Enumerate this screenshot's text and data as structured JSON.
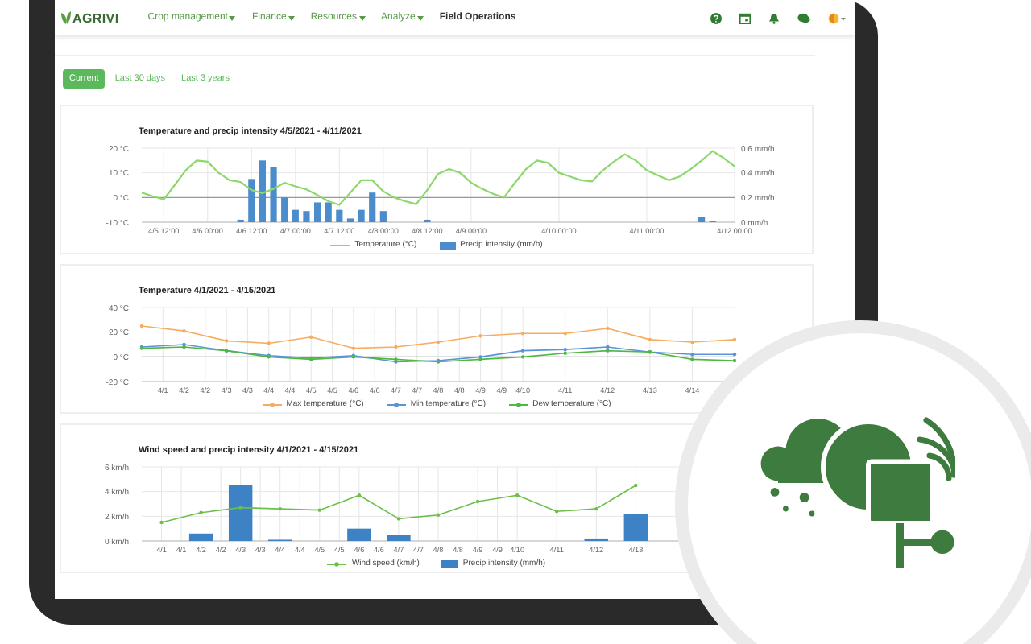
{
  "navbar": {
    "logo": "AGRIVI",
    "menus": [
      {
        "label": "Crop management",
        "dropdown": true,
        "selected": false
      },
      {
        "label": "Finance",
        "dropdown": true,
        "selected": false
      },
      {
        "label": "Resources",
        "dropdown": true,
        "selected": false
      },
      {
        "label": "Analyze",
        "dropdown": true,
        "selected": false
      },
      {
        "label": "Field Operations",
        "dropdown": false,
        "selected": true
      }
    ]
  },
  "period_tabs": [
    {
      "label": "Current",
      "selected": true
    },
    {
      "label": "Last 30 days",
      "selected": false
    },
    {
      "label": "Last 3 years",
      "selected": false
    }
  ],
  "panels": [
    {
      "chart_data": {
        "type": "line",
        "title": "Temperature and precip intensity 4/5/2021 - 4/11/2021",
        "grid": true,
        "legend": true,
        "categories": [
          null,
          null,
          "4/5 12:00",
          null,
          null,
          null,
          "4/6 00:00",
          null,
          null,
          null,
          "4/6 12:00",
          null,
          null,
          null,
          "4/7 00:00",
          null,
          null,
          null,
          "4/7 12:00",
          null,
          null,
          null,
          "4/8 00:00",
          null,
          null,
          null,
          "4/8 12:00",
          null,
          null,
          null,
          "4/9 00:00",
          null,
          null,
          null,
          null,
          null,
          null,
          null,
          "4/10 00:00",
          null,
          null,
          null,
          null,
          null,
          null,
          null,
          "4/11 00:00",
          null,
          null,
          null,
          null,
          null,
          null,
          null,
          "4/12 00:00"
        ],
        "ylim": [
          -10,
          20
        ],
        "yticks": [
          {
            "value": -10,
            "label": "-10 °C"
          },
          {
            "value": 0,
            "label": "0 °C"
          },
          {
            "value": 10,
            "label": "10 °C"
          },
          {
            "value": 20,
            "label": "20 °C"
          }
        ],
        "y2lim": [
          0,
          0.6
        ],
        "y2ticks": [
          {
            "value": 0,
            "label": "0 mm/h"
          },
          {
            "value": 0.2,
            "label": "0.2 mm/h"
          },
          {
            "value": 0.4,
            "label": "0.4 mm/h"
          },
          {
            "value": 0.6,
            "label": "0.6 mm/h"
          }
        ],
        "series": [
          {
            "name": "Temperature (°C)",
            "type": "line",
            "color": "#8cd86a",
            "values": [
              2,
              0.5,
              -0.8,
              5,
              11,
              15,
              14.5,
              10,
              7,
              6.3,
              3,
              1.8,
              3.5,
              6,
              4.5,
              3.3,
              1,
              -1.5,
              -3,
              2,
              7,
              7,
              2.5,
              0,
              -1.5,
              -2.7,
              3,
              9.6,
              11.5,
              10,
              6,
              3.5,
              1.5,
              0,
              6,
              11.5,
              15,
              14,
              10,
              8.5,
              7,
              6.5,
              11,
              14.5,
              17.5,
              15,
              11,
              9,
              7,
              8.5,
              11.5,
              15,
              18.8,
              16,
              12.6
            ]
          },
          {
            "name": "Precip intensity (mm/h)",
            "type": "bar",
            "axis": "y2",
            "color": "#4a8ccc",
            "values": [
              0,
              0,
              0,
              0,
              0,
              0,
              0,
              0,
              0,
              0.02,
              0.35,
              0.5,
              0.45,
              0.2,
              0.1,
              0.09,
              0.16,
              0.16,
              0.1,
              0.03,
              0.1,
              0.24,
              0.09,
              0,
              0,
              0,
              0.02,
              0,
              0,
              0,
              0,
              0,
              0,
              0,
              0,
              0,
              0,
              0,
              0,
              0,
              0,
              0,
              0,
              0,
              0,
              0,
              0,
              0,
              0,
              0,
              0,
              0.04,
              0.01,
              0,
              0
            ]
          }
        ]
      }
    },
    {
      "chart_data": {
        "type": "line",
        "title": "Temperature 4/1/2021 - 4/15/2021",
        "grid": true,
        "legend": true,
        "categories": [
          null,
          "4/1",
          "4/2",
          "4/2",
          "4/3",
          "4/3",
          "4/4",
          "4/4",
          "4/5",
          "4/5",
          "4/6",
          "4/6",
          "4/7",
          "4/7",
          "4/8",
          "4/8",
          "4/9",
          "4/9",
          "4/10",
          null,
          "4/11",
          null,
          "4/12",
          null,
          "4/13",
          null,
          "4/14",
          null,
          null
        ],
        "ylim": [
          -20,
          40
        ],
        "yticks": [
          {
            "value": -20,
            "label": "-20 °C"
          },
          {
            "value": 0,
            "label": "0 °C"
          },
          {
            "value": 20,
            "label": "20 °C"
          },
          {
            "value": 40,
            "label": "40 °C"
          }
        ],
        "series": [
          {
            "name": "Max temperature (°C)",
            "color": "#f5ad62",
            "values": [
              25,
              null,
              21,
              null,
              13,
              null,
              11,
              null,
              16,
              null,
              7,
              null,
              8,
              null,
              12,
              null,
              17,
              null,
              19,
              null,
              19,
              null,
              23,
              null,
              14,
              null,
              12,
              null,
              14
            ]
          },
          {
            "name": "Min temperature (°C)",
            "color": "#5b93d9",
            "values": [
              8,
              null,
              10,
              null,
              5,
              null,
              1,
              null,
              -1,
              null,
              1,
              null,
              -4,
              null,
              -3,
              null,
              0,
              null,
              5,
              null,
              6,
              null,
              8,
              null,
              4,
              null,
              2,
              null,
              2
            ]
          },
          {
            "name": "Dew temperature (°C)",
            "color": "#4fb845",
            "values": [
              7,
              null,
              8,
              null,
              5,
              null,
              0,
              null,
              -2,
              null,
              0,
              null,
              -2,
              null,
              -4,
              null,
              -2,
              null,
              0,
              null,
              3,
              null,
              5,
              null,
              4,
              null,
              -2,
              null,
              -3
            ]
          }
        ]
      }
    },
    {
      "chart_data": {
        "type": "bar",
        "title": "Wind speed and precip intensity 4/1/2021 - 4/15/2021",
        "grid": true,
        "legend": true,
        "categories": [
          "4/1",
          "4/1",
          "4/2",
          "4/2",
          "4/3",
          "4/3",
          "4/4",
          "4/4",
          "4/5",
          "4/5",
          "4/6",
          "4/6",
          "4/7",
          "4/7",
          "4/8",
          "4/8",
          "4/9",
          "4/9",
          "4/10",
          null,
          "4/11",
          null,
          "4/12",
          null,
          "4/13",
          null,
          null
        ],
        "ylim": [
          0,
          6
        ],
        "yticks": [
          {
            "value": 0,
            "label": "0 km/h"
          },
          {
            "value": 2,
            "label": "2 km/h"
          },
          {
            "value": 4,
            "label": "4 km/h"
          },
          {
            "value": 6,
            "label": "6 km/h"
          }
        ],
        "series": [
          {
            "name": "Wind speed (km/h)",
            "type": "line",
            "color": "#6cc04a",
            "values": [
              1.5,
              null,
              2.3,
              null,
              2.7,
              null,
              2.6,
              null,
              2.5,
              null,
              3.7,
              null,
              1.8,
              null,
              2.1,
              null,
              3.2,
              null,
              3.7,
              null,
              2.4,
              null,
              2.6,
              null,
              4.5,
              null,
              null
            ]
          },
          {
            "name": "Precip intensity (mm/h)",
            "type": "bar",
            "color": "#3d82c4",
            "values": [
              0,
              null,
              0.6,
              null,
              4.5,
              null,
              0.1,
              null,
              0,
              null,
              1.0,
              null,
              0.5,
              null,
              0,
              null,
              0,
              null,
              0,
              null,
              0,
              null,
              0.2,
              null,
              2.2,
              null,
              null
            ]
          }
        ]
      }
    }
  ]
}
